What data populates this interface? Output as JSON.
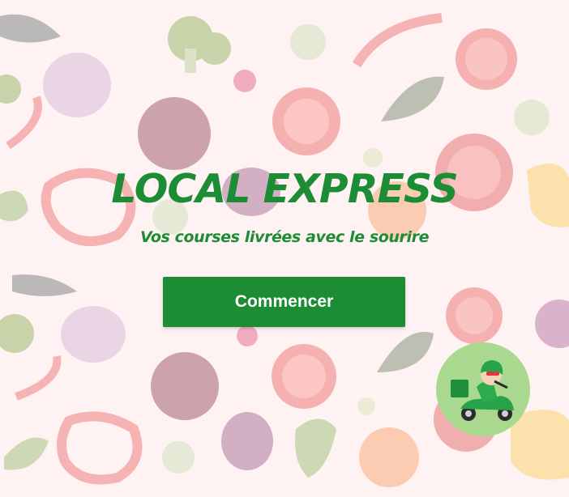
{
  "app": {
    "brand_title": "LOCAL EXPRESS",
    "tagline": "Vos courses livrées avec le sourire",
    "start_button_label": "Commencer"
  },
  "colors": {
    "accent": "#1c8c35",
    "background": "#fbeef0",
    "button_text": "#ffffff"
  },
  "icons": {
    "mascot": "delivery-scooter-mascot-icon",
    "background": "vegetables-pattern"
  }
}
